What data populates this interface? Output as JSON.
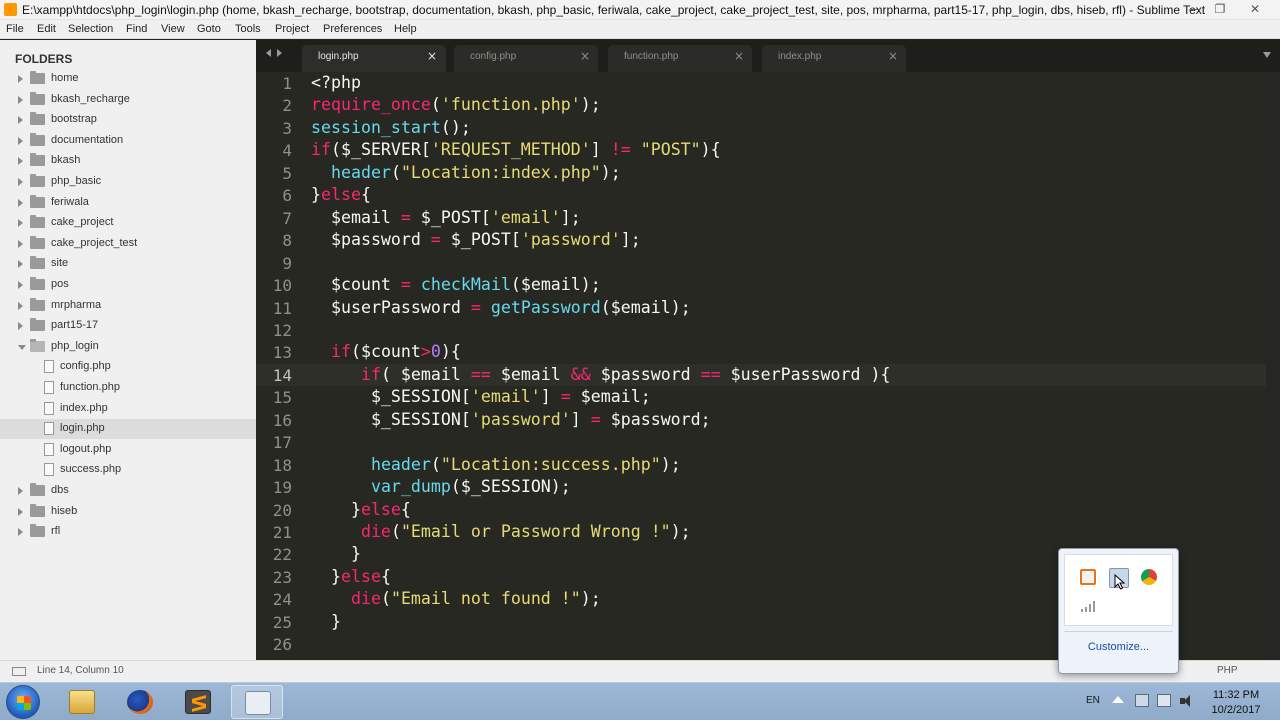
{
  "window": {
    "title": "E:\\xampp\\htdocs\\php_login\\login.php (home, bkash_recharge, bootstrap, documentation, bkash, php_basic, feriwala, cake_project, cake_project_test, site, pos, mrpharma, part15-17, php_login, dbs, hiseb, rfl) - Sublime Text",
    "minimize": "—",
    "maximize": "❐",
    "close": "✕"
  },
  "menu": [
    "File",
    "Edit",
    "Selection",
    "Find",
    "View",
    "Goto",
    "Tools",
    "Project",
    "Preferences",
    "Help"
  ],
  "sidebar": {
    "header": "FOLDERS",
    "items": [
      {
        "label": "home",
        "type": "folder",
        "depth": 0
      },
      {
        "label": "bkash_recharge",
        "type": "folder",
        "depth": 0
      },
      {
        "label": "bootstrap",
        "type": "folder",
        "depth": 0
      },
      {
        "label": "documentation",
        "type": "folder",
        "depth": 0
      },
      {
        "label": "bkash",
        "type": "folder",
        "depth": 0
      },
      {
        "label": "php_basic",
        "type": "folder",
        "depth": 0
      },
      {
        "label": "feriwala",
        "type": "folder",
        "depth": 0
      },
      {
        "label": "cake_project",
        "type": "folder",
        "depth": 0
      },
      {
        "label": "cake_project_test",
        "type": "folder",
        "depth": 0
      },
      {
        "label": "site",
        "type": "folder",
        "depth": 0
      },
      {
        "label": "pos",
        "type": "folder",
        "depth": 0
      },
      {
        "label": "mrpharma",
        "type": "folder",
        "depth": 0
      },
      {
        "label": "part15-17",
        "type": "folder",
        "depth": 0
      },
      {
        "label": "php_login",
        "type": "folder-open",
        "depth": 0
      },
      {
        "label": "config.php",
        "type": "file",
        "depth": 1
      },
      {
        "label": "function.php",
        "type": "file",
        "depth": 1
      },
      {
        "label": "index.php",
        "type": "file",
        "depth": 1
      },
      {
        "label": "login.php",
        "type": "file",
        "depth": 1,
        "selected": true
      },
      {
        "label": "logout.php",
        "type": "file",
        "depth": 1
      },
      {
        "label": "success.php",
        "type": "file",
        "depth": 1
      },
      {
        "label": "dbs",
        "type": "folder",
        "depth": 0
      },
      {
        "label": "hiseb",
        "type": "folder",
        "depth": 0
      },
      {
        "label": "rfl",
        "type": "folder",
        "depth": 0
      }
    ]
  },
  "tabs": [
    {
      "label": "login.php",
      "active": true,
      "close": "×"
    },
    {
      "label": "config.php",
      "active": false,
      "close": "×"
    },
    {
      "label": "function.php",
      "active": false,
      "close": "×"
    },
    {
      "label": "index.php",
      "active": false,
      "close": "×"
    }
  ],
  "editor": {
    "current_line": 14,
    "lines": [
      [
        [
          "plain",
          "<?php"
        ]
      ],
      [
        [
          "kw",
          "require_once"
        ],
        [
          "plain",
          "("
        ],
        [
          "str",
          "'function.php'"
        ],
        [
          "plain",
          ");"
        ]
      ],
      [
        [
          "fn",
          "session_start"
        ],
        [
          "plain",
          "();"
        ]
      ],
      [
        [
          "kw",
          "if"
        ],
        [
          "plain",
          "($_SERVER["
        ],
        [
          "str",
          "'REQUEST_METHOD'"
        ],
        [
          "plain",
          "] "
        ],
        [
          "op",
          "!="
        ],
        [
          "plain",
          " "
        ],
        [
          "str",
          "\"POST\""
        ],
        [
          "plain",
          "){"
        ]
      ],
      [
        [
          "plain",
          "  "
        ],
        [
          "fn",
          "header"
        ],
        [
          "plain",
          "("
        ],
        [
          "str",
          "\"Location:index.php\""
        ],
        [
          "plain",
          ");"
        ]
      ],
      [
        [
          "plain",
          "}"
        ],
        [
          "kw",
          "else"
        ],
        [
          "plain",
          "{"
        ]
      ],
      [
        [
          "plain",
          "  $email "
        ],
        [
          "op",
          "="
        ],
        [
          "plain",
          " $_POST["
        ],
        [
          "str",
          "'email'"
        ],
        [
          "plain",
          "];"
        ]
      ],
      [
        [
          "plain",
          "  $password "
        ],
        [
          "op",
          "="
        ],
        [
          "plain",
          " $_POST["
        ],
        [
          "str",
          "'password'"
        ],
        [
          "plain",
          "];"
        ]
      ],
      [
        [
          "plain",
          ""
        ]
      ],
      [
        [
          "plain",
          "  $count "
        ],
        [
          "op",
          "="
        ],
        [
          "plain",
          " "
        ],
        [
          "fn",
          "checkMail"
        ],
        [
          "plain",
          "($email);"
        ]
      ],
      [
        [
          "plain",
          "  $userPassword "
        ],
        [
          "op",
          "="
        ],
        [
          "plain",
          " "
        ],
        [
          "fn",
          "getPassword"
        ],
        [
          "plain",
          "($email);"
        ]
      ],
      [
        [
          "plain",
          ""
        ]
      ],
      [
        [
          "plain",
          "  "
        ],
        [
          "kw",
          "if"
        ],
        [
          "plain",
          "($count"
        ],
        [
          "op",
          ">"
        ],
        [
          "num",
          "0"
        ],
        [
          "plain",
          "){"
        ]
      ],
      [
        [
          "plain",
          "     "
        ],
        [
          "kw",
          "if"
        ],
        [
          "plain",
          "( $email "
        ],
        [
          "op",
          "=="
        ],
        [
          "plain",
          " $email "
        ],
        [
          "op",
          "&&"
        ],
        [
          "plain",
          " $password "
        ],
        [
          "op",
          "=="
        ],
        [
          "plain",
          " $userPassword ){"
        ]
      ],
      [
        [
          "plain",
          "      $_SESSION["
        ],
        [
          "str",
          "'email'"
        ],
        [
          "plain",
          "] "
        ],
        [
          "op",
          "="
        ],
        [
          "plain",
          " $email;"
        ]
      ],
      [
        [
          "plain",
          "      $_SESSION["
        ],
        [
          "str",
          "'password'"
        ],
        [
          "plain",
          "] "
        ],
        [
          "op",
          "="
        ],
        [
          "plain",
          " $password;"
        ]
      ],
      [
        [
          "plain",
          ""
        ]
      ],
      [
        [
          "plain",
          "      "
        ],
        [
          "fn",
          "header"
        ],
        [
          "plain",
          "("
        ],
        [
          "str",
          "\"Location:success.php\""
        ],
        [
          "plain",
          ");"
        ]
      ],
      [
        [
          "plain",
          "      "
        ],
        [
          "fn",
          "var_dump"
        ],
        [
          "plain",
          "($_SESSION);"
        ]
      ],
      [
        [
          "plain",
          "    }"
        ],
        [
          "kw",
          "else"
        ],
        [
          "plain",
          "{"
        ]
      ],
      [
        [
          "plain",
          "     "
        ],
        [
          "kw",
          "die"
        ],
        [
          "plain",
          "("
        ],
        [
          "str",
          "\"Email or Password Wrong !\""
        ],
        [
          "plain",
          ");"
        ]
      ],
      [
        [
          "plain",
          "    }"
        ]
      ],
      [
        [
          "plain",
          "  }"
        ],
        [
          "kw",
          "else"
        ],
        [
          "plain",
          "{"
        ]
      ],
      [
        [
          "plain",
          "    "
        ],
        [
          "kw",
          "die"
        ],
        [
          "plain",
          "("
        ],
        [
          "str",
          "\"Email not found !\""
        ],
        [
          "plain",
          ");"
        ]
      ],
      [
        [
          "plain",
          "  }"
        ]
      ],
      [
        [
          "plain",
          ""
        ]
      ]
    ]
  },
  "statusbar": {
    "position": "Line 14, Column 10",
    "syntax": "PHP"
  },
  "tray_popup": {
    "customize": "Customize..."
  },
  "taskbar": {
    "language": "EN",
    "time": "11:32 PM",
    "date": "10/2/2017"
  },
  "colors": {
    "editor_bg": "#272822",
    "keyword": "#f92672",
    "function": "#66d9ef",
    "string": "#e6db74",
    "number": "#ae81ff",
    "text": "#f8f8f2",
    "accent": "#ff9800"
  }
}
